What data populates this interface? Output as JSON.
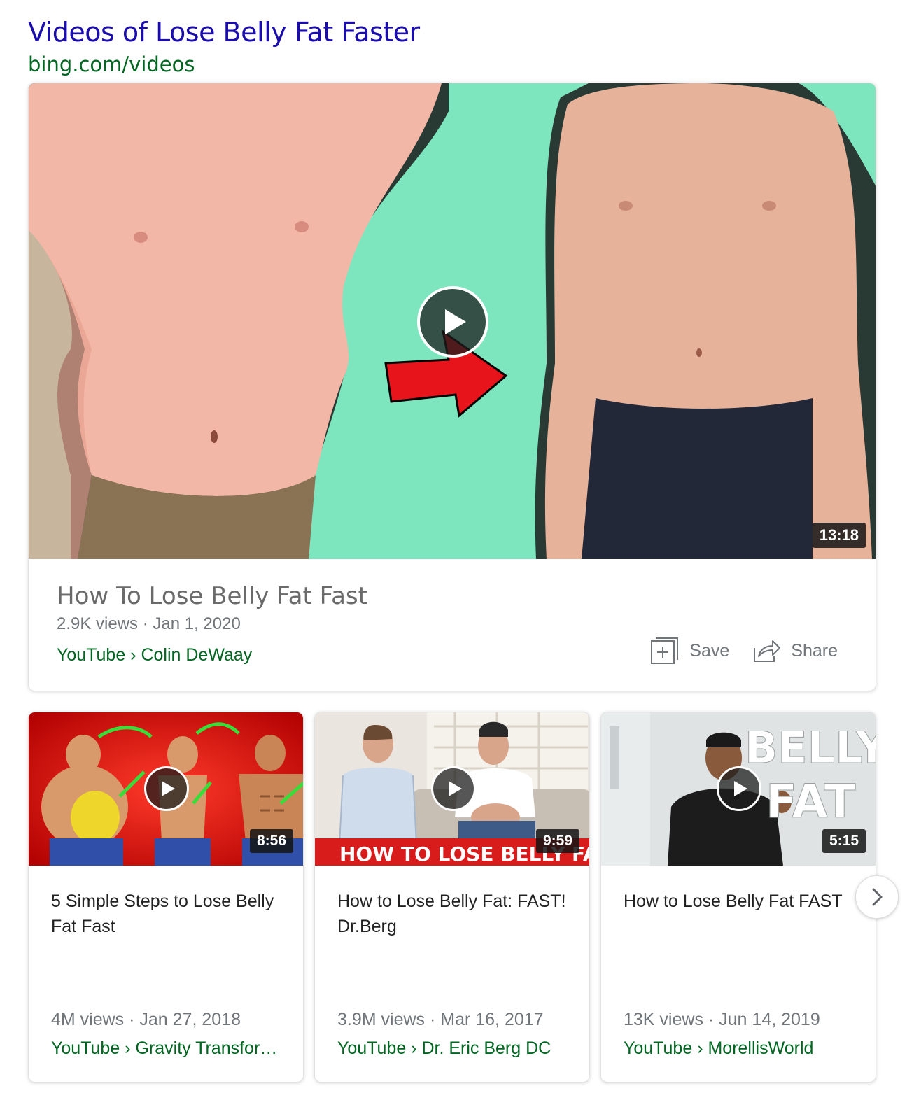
{
  "header": {
    "title": "Videos of Lose Belly Fat Faster",
    "url": "bing.com/videos"
  },
  "main_video": {
    "title": "How To Lose Belly Fat Fast",
    "meta": "2.9K views · Jan 1, 2020",
    "source": "YouTube › Colin DeWaay",
    "duration": "13:18",
    "save_label": "Save",
    "share_label": "Share",
    "thumbnail_colors": {
      "background": "#7ee6bf",
      "arrow": "#e8141b"
    }
  },
  "videos": [
    {
      "title": "5 Simple Steps to Lose Belly Fat Fast",
      "meta": "4M views · Jan 27, 2018",
      "source": "YouTube › Gravity Transfor…",
      "duration": "8:56"
    },
    {
      "title": "How to Lose Belly Fat: FAST! Dr.Berg",
      "meta": "3.9M views · Mar 16, 2017",
      "source": "YouTube › Dr. Eric Berg DC",
      "duration": "9:59",
      "thumb_caption": "HOW TO LOSE BELLY FAT"
    },
    {
      "title": "How to Lose Belly Fat FAST",
      "meta": "13K views · Jun 14, 2019",
      "source": "YouTube › MorellisWorld",
      "duration": "5:15",
      "thumb_word_1": "BELLY",
      "thumb_word_2": "FAT"
    }
  ],
  "icons": {
    "play": "play-icon",
    "save": "save-plus-icon",
    "share": "share-arrow-icon",
    "next": "chevron-right-icon"
  }
}
